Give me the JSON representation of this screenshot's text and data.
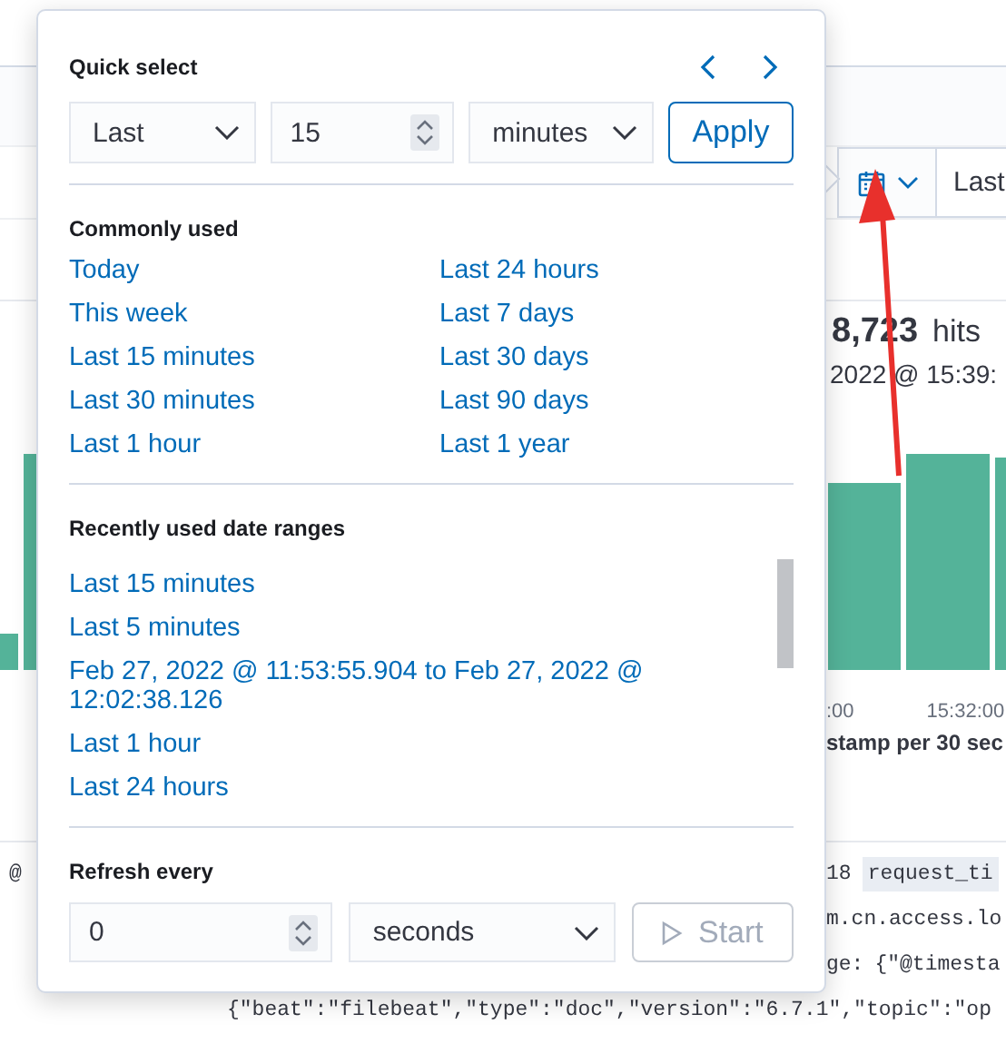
{
  "background": {
    "date_picker": {
      "label": "Last"
    },
    "hits": {
      "count": "8,723",
      "label": "hits"
    },
    "date_range": "2022 @ 15:39:",
    "histogram": {
      "x_labels": [
        ":00",
        "15:32:00"
      ],
      "axis_title": "stamp per 30 sec"
    },
    "documents": {
      "marker": "@",
      "lines": [
        {
          "kind": "field",
          "number": "18",
          "field": "request_ti"
        },
        {
          "kind": "text",
          "text": "m.cn.access.lo"
        },
        {
          "kind": "key_value",
          "key": "ge:",
          "text": "{\"@timesta"
        },
        {
          "kind": "source",
          "text": "{\"beat\":\"filebeat\",\"type\":\"doc\",\"version\":\"6.7.1\",\"topic\":\"op"
        }
      ]
    }
  },
  "popover": {
    "quick_select": {
      "title": "Quick select",
      "direction": "Last",
      "amount": "15",
      "unit": "minutes",
      "apply_button": "Apply"
    },
    "commonly_used": {
      "title": "Commonly used",
      "items": [
        "Today",
        "Last 24 hours",
        "This week",
        "Last 7 days",
        "Last 15 minutes",
        "Last 30 days",
        "Last 30 minutes",
        "Last 90 days",
        "Last 1 hour",
        "Last 1 year"
      ]
    },
    "recently_used": {
      "title": "Recently used date ranges",
      "items": [
        "Last 15 minutes",
        "Last 5 minutes",
        "Feb 27, 2022 @ 11:53:55.904 to Feb 27, 2022 @ 12:02:38.126",
        "Last 1 hour",
        "Last 24 hours"
      ]
    },
    "refresh": {
      "title": "Refresh every",
      "interval": "0",
      "unit": "seconds",
      "start_button": {
        "label": "Start",
        "disabled": true
      }
    }
  }
}
